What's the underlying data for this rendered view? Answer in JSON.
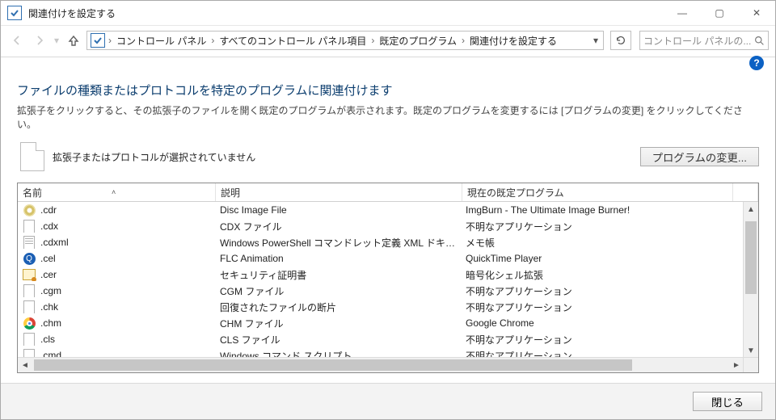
{
  "window": {
    "title": "関連付けを設定する"
  },
  "winbuttons": {
    "min": "—",
    "max": "▢",
    "close": "✕"
  },
  "breadcrumbs": {
    "items": [
      "コントロール パネル",
      "すべてのコントロール パネル項目",
      "既定のプログラム",
      "関連付けを設定する"
    ]
  },
  "search": {
    "placeholder": "コントロール パネルの..."
  },
  "page": {
    "heading": "ファイルの種類またはプロトコルを特定のプログラムに関連付けます",
    "explain": "拡張子をクリックすると、その拡張子のファイルを開く既定のプログラムが表示されます。既定のプログラムを変更するには [プログラムの変更] をクリックしてください。",
    "no_selection": "拡張子またはプロトコルが選択されていません",
    "change_button": "プログラムの変更..."
  },
  "columns": {
    "name": "名前",
    "desc": "説明",
    "prog": "現在の既定プログラム"
  },
  "rows": [
    {
      "ext": ".cdr",
      "icon": "disc",
      "desc": "Disc Image File",
      "prog": "ImgBurn - The Ultimate Image Burner!"
    },
    {
      "ext": ".cdx",
      "icon": "page",
      "desc": "CDX ファイル",
      "prog": "不明なアプリケーション"
    },
    {
      "ext": ".cdxml",
      "icon": "lines",
      "desc": "Windows PowerShell コマンドレット定義 XML ドキュメント",
      "prog": "メモ帳"
    },
    {
      "ext": ".cel",
      "icon": "q",
      "desc": "FLC Animation",
      "prog": "QuickTime Player"
    },
    {
      "ext": ".cer",
      "icon": "cert",
      "desc": "セキュリティ証明書",
      "prog": "暗号化シェル拡張"
    },
    {
      "ext": ".cgm",
      "icon": "page",
      "desc": "CGM ファイル",
      "prog": "不明なアプリケーション"
    },
    {
      "ext": ".chk",
      "icon": "page",
      "desc": "回復されたファイルの断片",
      "prog": "不明なアプリケーション"
    },
    {
      "ext": ".chm",
      "icon": "chrome",
      "desc": "CHM ファイル",
      "prog": "Google Chrome"
    },
    {
      "ext": ".cls",
      "icon": "page",
      "desc": "CLS ファイル",
      "prog": "不明なアプリケーション"
    },
    {
      "ext": ".cmd",
      "icon": "page",
      "desc": "Windows コマンド スクリプト",
      "prog": "不明なアプリケーション"
    }
  ],
  "footer": {
    "close": "閉じる"
  },
  "help": "?"
}
